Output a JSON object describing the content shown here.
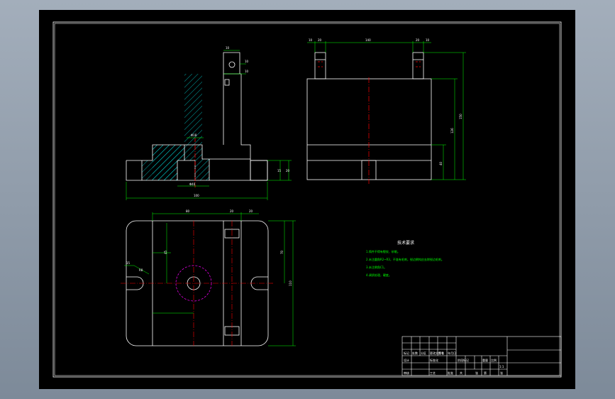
{
  "colors": {
    "background": "#000000",
    "outline": "#ffffff",
    "dimension": "#00ff00",
    "centerline": "#ff0000",
    "hidden": "#ff00ff",
    "hatch": "#00ffff"
  },
  "front_view": {
    "dims": [
      "10",
      "10",
      "10",
      "Φ18",
      "Φ40",
      "100",
      "15",
      "20"
    ]
  },
  "side_view": {
    "dims": [
      "10",
      "20",
      "140",
      "20",
      "10",
      "126",
      "150",
      "40"
    ]
  },
  "top_view": {
    "dims": [
      "80",
      "20",
      "20",
      "R8",
      "45",
      "15",
      "70",
      "110"
    ]
  },
  "notes": {
    "title": "技术要求",
    "lines": [
      "1.铸件不得有裂纹、砂眼。",
      "2.未注圆角R2~R3，不准有毛刺，锐边倒钝应去除锐边毛刺。",
      "3.未注倒角C1。",
      "4.调质处理，硬度。"
    ]
  },
  "title_block": {
    "cells": [
      "标记",
      "处数",
      "分区",
      "更改文件号",
      "签名",
      "年月日",
      "设计",
      "标准化",
      "阶段标记",
      "重量",
      "比例",
      "审核",
      "工艺",
      "批准",
      "共",
      "张",
      "第",
      "张",
      "1:1"
    ]
  }
}
